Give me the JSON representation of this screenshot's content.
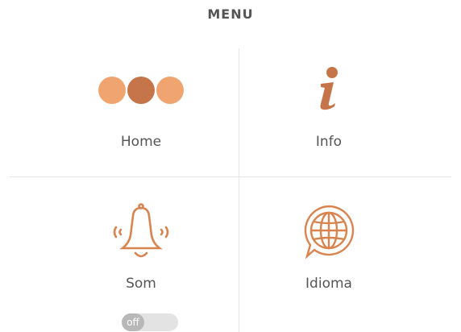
{
  "header": {
    "title": "MENU"
  },
  "tiles": [
    {
      "id": "home",
      "label": "Home",
      "icon": "dots-icon"
    },
    {
      "id": "info",
      "label": "Info",
      "icon": "info-icon"
    },
    {
      "id": "som",
      "label": "Som",
      "icon": "bell-icon"
    },
    {
      "id": "idioma",
      "label": "Idioma",
      "icon": "globe-icon"
    }
  ],
  "sound_toggle": {
    "state": "off"
  },
  "colors": {
    "accent": "#f0a470",
    "accent_dark": "#c6754a",
    "text": "#555555",
    "divider": "#e6e6e6",
    "toggle_track": "#e3e3e3",
    "toggle_knob": "#b8b8b8"
  }
}
